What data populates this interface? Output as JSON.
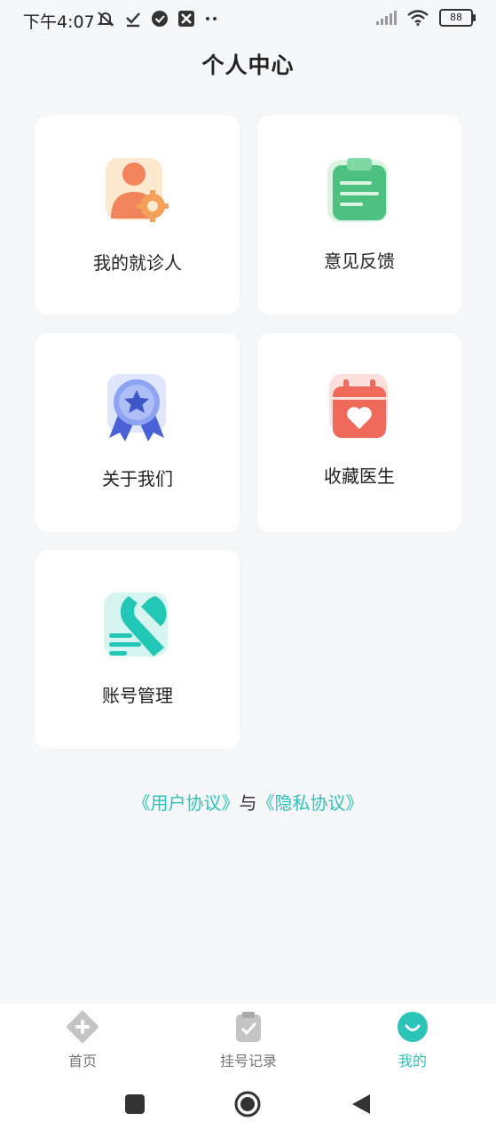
{
  "status_bar": {
    "time": "下午4:07",
    "battery": "88"
  },
  "header": {
    "title": "个人中心"
  },
  "menu": [
    {
      "label": "我的就诊人",
      "icon": "patient-icon"
    },
    {
      "label": "意见反馈",
      "icon": "feedback-clipboard-icon"
    },
    {
      "label": "关于我们",
      "icon": "award-badge-icon"
    },
    {
      "label": "收藏医生",
      "icon": "calendar-heart-icon"
    },
    {
      "label": "账号管理",
      "icon": "wrench-icon"
    }
  ],
  "agreement": {
    "user_agreement": "《用户协议》",
    "separator": "与",
    "privacy_policy": "《隐私协议》"
  },
  "tabbar": [
    {
      "label": "首页",
      "icon": "home-plus-icon",
      "active": false
    },
    {
      "label": "挂号记录",
      "icon": "clipboard-check-icon",
      "active": false
    },
    {
      "label": "我的",
      "icon": "smile-icon",
      "active": true
    }
  ],
  "colors": {
    "accent": "#2cc3b8",
    "background": "#f5f6f8",
    "card": "#ffffff"
  }
}
